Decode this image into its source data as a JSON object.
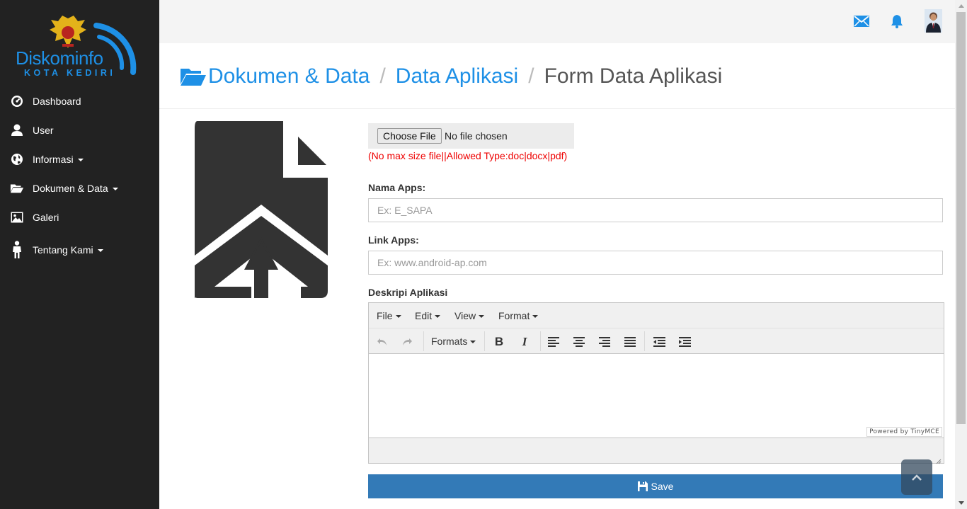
{
  "brand": {
    "name": "Diskominfo",
    "subtitle": "KOTA KEDIRI",
    "accent": "#1e90e6"
  },
  "sidebar": {
    "items": [
      {
        "label": "Dashboard",
        "icon": "dashboard-icon"
      },
      {
        "label": "User",
        "icon": "user-icon"
      },
      {
        "label": "Informasi",
        "icon": "globe-icon",
        "dropdown": true
      },
      {
        "label": "Dokumen & Data",
        "icon": "folder-open-icon",
        "dropdown": true
      },
      {
        "label": "Galeri",
        "icon": "picture-icon"
      },
      {
        "label": "Tentang Kami",
        "icon": "person-icon",
        "dropdown": true
      }
    ]
  },
  "topbar": {
    "icons": [
      "envelope-icon",
      "bell-icon",
      "user-avatar"
    ]
  },
  "breadcrumb": {
    "icon": "folder-open-icon",
    "items": [
      "Dokumen & Data",
      "Data Aplikasi",
      "Form Data Aplikasi"
    ],
    "separator": "/"
  },
  "form": {
    "file": {
      "button_label": "Choose File",
      "status": "No file chosen",
      "hint": "(No max size file||Allowed Type:doc|docx|pdf)"
    },
    "nama_apps": {
      "label": "Nama Apps:",
      "placeholder": "Ex: E_SAPA",
      "value": ""
    },
    "link_apps": {
      "label": "Link Apps:",
      "placeholder": "Ex: www.android-ap.com",
      "value": ""
    },
    "deskripsi": {
      "label": "Deskripi Aplikasi"
    },
    "editor": {
      "menus": [
        "File",
        "Edit",
        "View",
        "Format"
      ],
      "formats_label": "Formats",
      "toolbar_icons": [
        "undo-icon",
        "redo-icon",
        "bold-icon",
        "italic-icon",
        "align-left-icon",
        "align-center-icon",
        "align-right-icon",
        "align-justify-icon",
        "outdent-icon",
        "indent-icon"
      ],
      "powered_by": "Powered by TinyMCE"
    },
    "save_label": "Save"
  },
  "colors": {
    "sidebar_bg": "#222222",
    "link": "#1e90e6",
    "primary_button": "#337ab7",
    "hint": "#ee0000"
  }
}
